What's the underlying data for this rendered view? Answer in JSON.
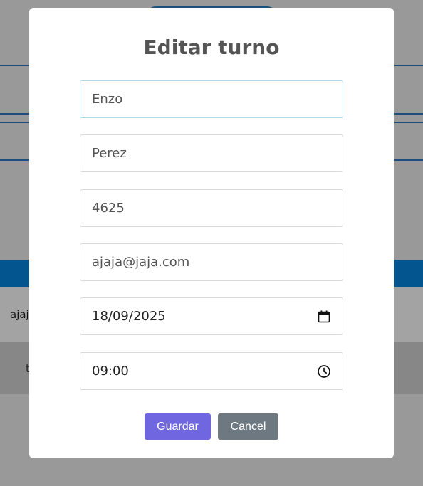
{
  "background": {
    "rows": [
      "ajaja",
      "t"
    ]
  },
  "modal": {
    "title": "Editar turno",
    "fields": [
      {
        "name": "nombre",
        "value": "Enzo"
      },
      {
        "name": "apellido",
        "value": "Perez"
      },
      {
        "name": "dni",
        "value": "4625"
      },
      {
        "name": "email",
        "value": "ajaja@jaja.com"
      },
      {
        "name": "fecha",
        "value": "18/09/2025",
        "icon": "calendar-icon"
      },
      {
        "name": "hora",
        "value": "09:00",
        "icon": "clock-icon"
      }
    ],
    "buttons": {
      "save_label": "Guardar",
      "cancel_label": "Cancel"
    }
  },
  "colors": {
    "overlay": "#999999",
    "save_button": "#7066e0",
    "cancel_button": "#6e7881",
    "header_bar": "#02558e"
  }
}
